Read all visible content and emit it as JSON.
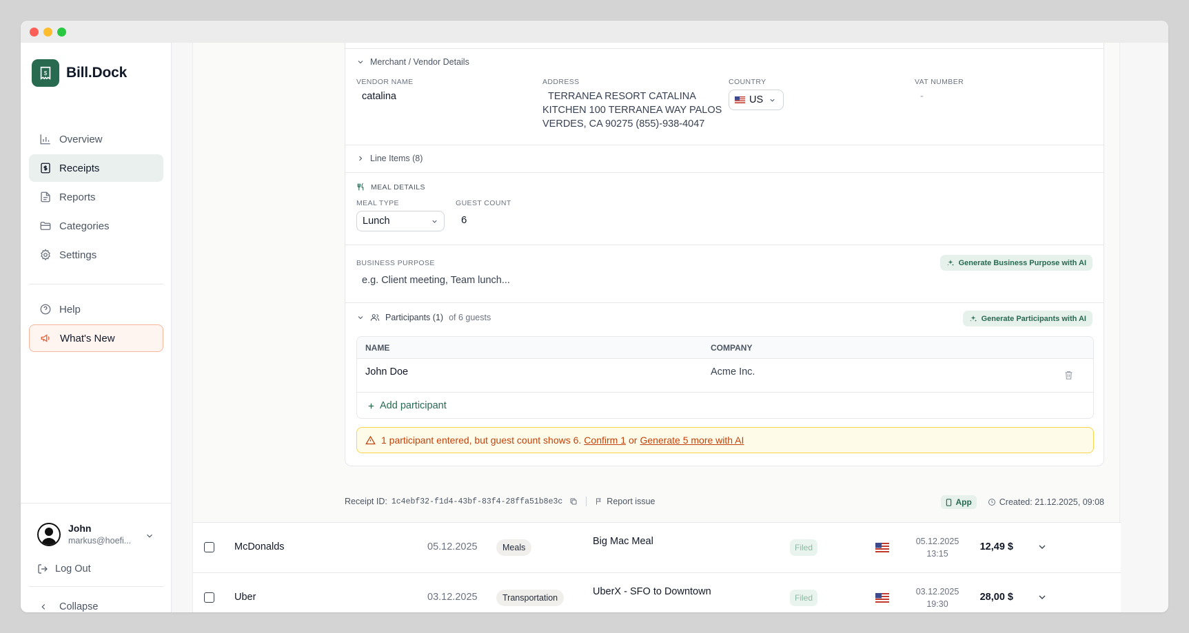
{
  "app": {
    "name": "Bill.Dock"
  },
  "sidebar": {
    "nav": [
      {
        "label": "Overview",
        "icon": "bar-chart-icon"
      },
      {
        "label": "Receipts",
        "icon": "receipt-icon",
        "active": true
      },
      {
        "label": "Reports",
        "icon": "document-icon"
      },
      {
        "label": "Categories",
        "icon": "folder-icon"
      },
      {
        "label": "Settings",
        "icon": "gear-icon"
      }
    ],
    "help": "Help",
    "whats_new": "What's New",
    "user": {
      "name": "John",
      "email": "markus@hoefi..."
    },
    "logout": "Log Out",
    "collapse": "Collapse"
  },
  "detail": {
    "merchant": {
      "header": "Merchant / Vendor Details",
      "vendor_label": "VENDOR NAME",
      "vendor_value": "catalina",
      "address_label": "ADDRESS",
      "address_lines": [
        "TERRANEA RESORT CATALINA",
        "KITCHEN 100 TERRANEA WAY PALOS",
        "VERDES, CA 90275 (855)-938-4047"
      ],
      "country_label": "COUNTRY",
      "country_value": "US",
      "vat_label": "VAT NUMBER",
      "vat_value": "-"
    },
    "line_items": {
      "header": "Line Items (8)"
    },
    "meal": {
      "header": "MEAL DETAILS",
      "type_label": "MEAL TYPE",
      "type_value": "Lunch",
      "guest_label": "GUEST COUNT",
      "guest_value": "6"
    },
    "purpose": {
      "label": "BUSINESS PURPOSE",
      "placeholder": "e.g. Client meeting, Team lunch...",
      "ai_button": "Generate Business Purpose with AI"
    },
    "participants": {
      "header": "Participants (1)",
      "sub": "of 6 guests",
      "ai_button": "Generate Participants with AI",
      "col_name": "NAME",
      "col_company": "COMPANY",
      "rows": [
        {
          "name": "John Doe",
          "company": "Acme Inc."
        }
      ],
      "add": "Add participant",
      "warning": {
        "text": "1 participant entered, but guest count shows 6.",
        "confirm": "Confirm 1",
        "or": "or",
        "generate": "Generate 5 more with AI"
      }
    },
    "meta": {
      "receipt_id_label": "Receipt ID:",
      "receipt_id": "1c4ebf32-f1d4-43bf-83f4-28ffa51b8e3c",
      "report_issue": "Report issue",
      "source": "App",
      "created": "Created: 21.12.2025, 09:08"
    }
  },
  "list": [
    {
      "merchant": "McDonalds",
      "date": "05.12.2025",
      "category": "Meals",
      "description": "Big Mac Meal",
      "status": "Filed",
      "created_date": "05.12.2025",
      "created_time": "13:15",
      "amount": "12,49 $"
    },
    {
      "merchant": "Uber",
      "date": "03.12.2025",
      "category": "Transportation",
      "description": "UberX - SFO to Downtown",
      "status": "Filed",
      "created_date": "03.12.2025",
      "created_time": "19:30",
      "amount": "28,00 $"
    }
  ],
  "colors": {
    "brand": "#276a50",
    "warning": "#c2410c",
    "accent_orange": "#e5623a"
  }
}
